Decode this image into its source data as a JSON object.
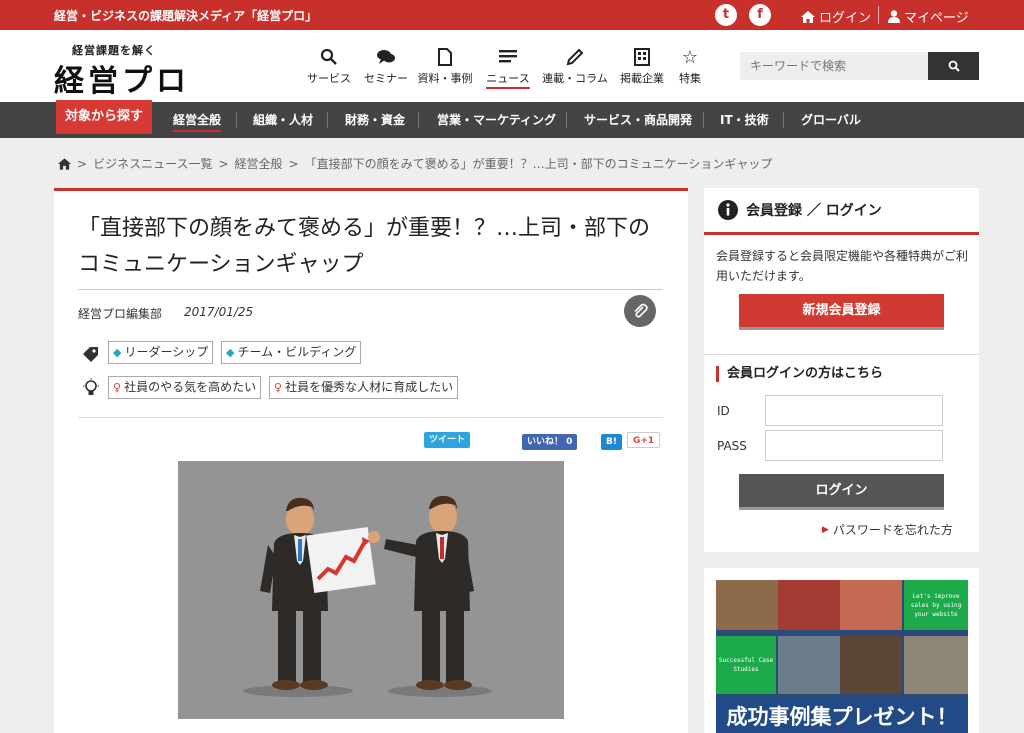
{
  "topbar": {
    "tagline": "経営・ビジネスの課題解決メディア「経営プロ」",
    "twitter_glyph": "t",
    "facebook_glyph": "f",
    "login": "ログイン",
    "mypage": "マイページ"
  },
  "header": {
    "logo_sub": "経営課題を解く",
    "logo_main": "経営プロ",
    "nav": [
      {
        "label": "サービス",
        "icon": "search-icon"
      },
      {
        "label": "セミナー",
        "icon": "chat-icon"
      },
      {
        "label": "資料・事例",
        "icon": "document-icon"
      },
      {
        "label": "ニュース",
        "icon": "news-icon"
      },
      {
        "label": "連載・コラム",
        "icon": "pencil-icon"
      },
      {
        "label": "掲載企業",
        "icon": "building-icon"
      },
      {
        "label": "特集",
        "icon": "star-icon"
      }
    ],
    "active_nav": "ニュース",
    "search_placeholder": "キーワードで検索"
  },
  "categories": {
    "find": "対象から探す",
    "items": [
      "経営全般",
      "組織・人材",
      "財務・資金",
      "営業・マーケティング",
      "サービス・商品開発",
      "IT・技術",
      "グローバル"
    ],
    "active": "経営全般"
  },
  "breadcrumb": {
    "items": [
      "ビジネスニュース一覧",
      "経営全般",
      "「直接部下の顔をみて褒める」が重要！？…上司・部下のコミュニケーションギャップ"
    ],
    "sep": ">"
  },
  "article": {
    "title": "「直接部下の顔をみて褒める」が重要！？…上司・部下のコミュニケーションギャップ",
    "author": "経営プロ編集部",
    "date": "2017/01/25",
    "tags": [
      "リーダーシップ",
      "チーム・ビルディング"
    ],
    "issues": [
      "社員のやる気を高めたい",
      "社員を優秀な人材に育成したい"
    ],
    "share": {
      "tweet": "ツイート",
      "like": "いいね！ 0",
      "hatena": "B!",
      "gplus": "G+1"
    }
  },
  "sidebar": {
    "heading": "会員登録 ／ ログイン",
    "desc": "会員登録すると会員限定機能や各種特典がご利用いただけます。",
    "register": "新規会員登録",
    "login_heading": "会員ログインの方はこちら",
    "id_label": "ID",
    "pass_label": "PASS",
    "login_btn": "ログイン",
    "forgot": "パスワードを忘れた方"
  },
  "banner": {
    "text1": "Let's improve sales by using your website",
    "text2": "Successful Case Studies",
    "headline": "成功事例集プレゼント！"
  },
  "colors": {
    "brand": "#c8302c",
    "dark": "#444444"
  }
}
